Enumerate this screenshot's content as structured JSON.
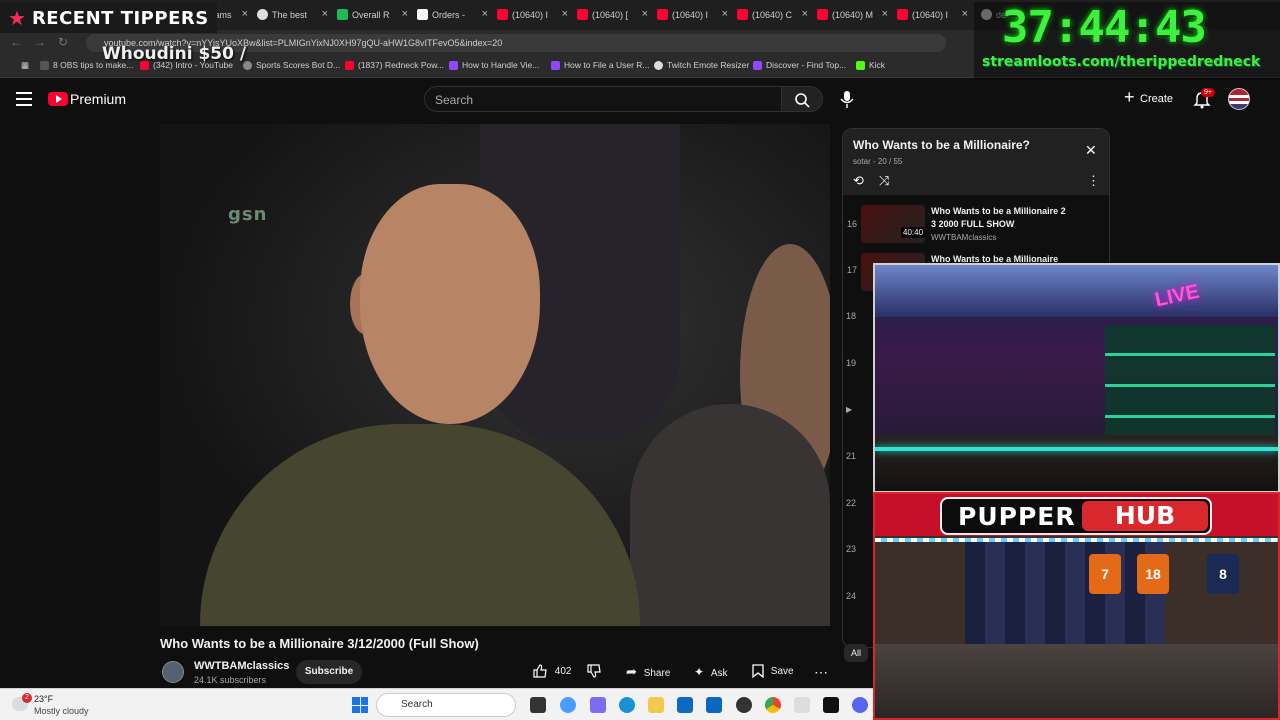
{
  "overlay": {
    "tippers_label": "RECENT TIPPERS",
    "tipper_name": "Whoudini $50 /",
    "timer": "37:44:43",
    "timer_link": "streamloots.com/therippedredneck",
    "pupper_left": "PUPPER",
    "pupper_right": "HUB"
  },
  "browser": {
    "tabs": [
      {
        "label": "Streams",
        "icon": "star-icon"
      },
      {
        "label": "The best",
        "icon": "gem-icon"
      },
      {
        "label": "Overall R",
        "icon": "k-icon"
      },
      {
        "label": "Orders -",
        "icon": "w-icon"
      },
      {
        "label": "(10640) I",
        "icon": "youtube-icon"
      },
      {
        "label": "(10640) [",
        "icon": "youtube-icon"
      },
      {
        "label": "(10640) I",
        "icon": "youtube-icon"
      },
      {
        "label": "(10640) C",
        "icon": "youtube-icon"
      },
      {
        "label": "(10640) M",
        "icon": "youtube-icon"
      },
      {
        "label": "(10640) I",
        "icon": "youtube-icon"
      },
      {
        "label": "de",
        "icon": "globe-icon"
      }
    ],
    "url": "youtube.com/watch?v=nYYisYUoXBw&list=PLMIGnYixNJ0XH97gQU-aHW1G8vITFevO5&index=20",
    "bookmarks": [
      {
        "label": "8 OBS tips to make..."
      },
      {
        "label": "(342) Intro - YouTube"
      },
      {
        "label": "Sports Scores Bot D..."
      },
      {
        "label": "(1837) Redneck Pow..."
      },
      {
        "label": "How to Handle Vie..."
      },
      {
        "label": "How to File a User R..."
      },
      {
        "label": "Twitch Emote Resizer"
      },
      {
        "label": "Discover - Find Top..."
      },
      {
        "label": "Kick"
      }
    ]
  },
  "youtube": {
    "brand": "Premium",
    "search_placeholder": "Search",
    "create_label": "Create",
    "notif_count": "9+",
    "video_watermark": "gsn",
    "video_title": "Who Wants to be a Millionaire 3/12/2000 (Full Show)",
    "channel": "WWTBAMclassics",
    "subscribers": "24.1K subscribers",
    "subscribe_label": "Subscribe",
    "likes": "402",
    "share_label": "Share",
    "ask_label": "Ask",
    "save_label": "Save"
  },
  "playlist": {
    "title": "Who Wants to be a Millionaire?",
    "meta": "sotar - 20 / 55",
    "items": [
      {
        "index": "16",
        "title": "Who Wants to be a Millionaire 2 3 2000 FULL SHOW",
        "channel": "WWTBAMclassics",
        "duration": "40:40"
      },
      {
        "index": "17",
        "title": "Who Wants to be a Millionaire",
        "channel": "",
        "duration": ""
      }
    ],
    "more_indices": [
      "18",
      "19",
      "21",
      "22",
      "23",
      "24"
    ],
    "all_chip": "All"
  },
  "taskbar": {
    "notif_badge": "2",
    "temperature": "23°F",
    "condition": "Mostly cloudy",
    "search_label": "Search"
  }
}
